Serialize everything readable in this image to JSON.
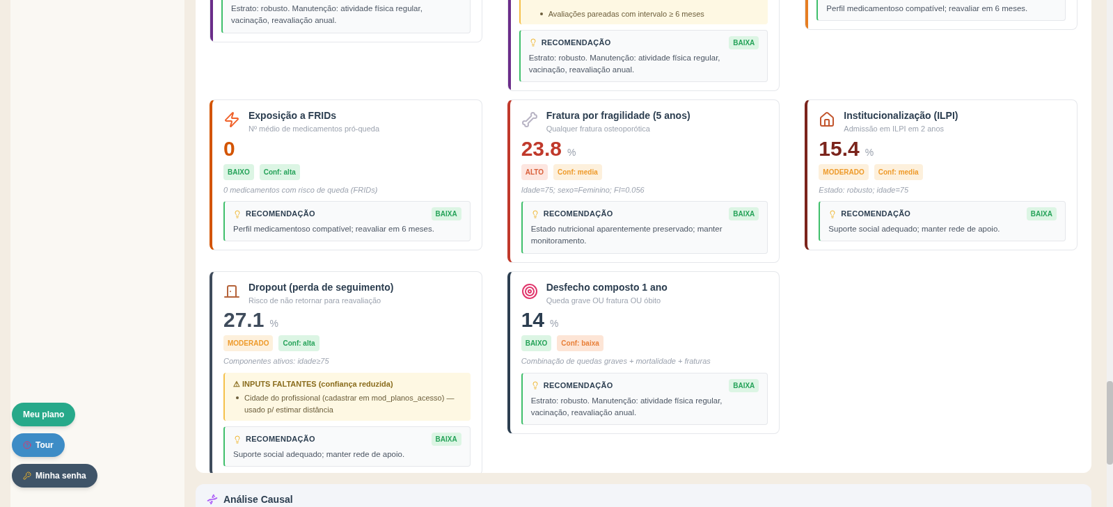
{
  "partial_cards": [
    {
      "color": "#6b2d8a",
      "recommendation": "Estrato: robusto. Manutenção: atividade física regular, vacinação, reavaliação anual."
    },
    {
      "color": "#6b2d8a",
      "missing": [
        "Avaliações pareadas com intervalo ≥ 6 meses"
      ],
      "rec_header": {
        "title": "RECOMENDAÇÃO",
        "priority": "BAIXA"
      },
      "recommendation": "Estrato: robusto. Manutenção: atividade física regular, vacinação, reavaliação anual."
    },
    {
      "color": "#e67e22",
      "recommendation": "Perfil medicamentoso compatível; reavaliar em 6 meses."
    }
  ],
  "cards": [
    {
      "title": "Exposição a FRIDs",
      "subtitle": "Nº médio de medicamentos pró-queda",
      "value": "0",
      "color": "#d35400",
      "badges": [
        {
          "text": "BAIXO",
          "kind": "green"
        },
        {
          "text": "Conf: alta",
          "kind": "green"
        }
      ],
      "note": "0 medicamentos com risco de queda (FRIDs)",
      "rec_title": "RECOMENDAÇÃO",
      "rec_priority": "BAIXA",
      "recommendation": "Perfil medicamentoso compatível; reavaliar em 6 meses."
    },
    {
      "title": "Fratura por fragilidade (5 anos)",
      "subtitle": "Qualquer fratura osteoporótica",
      "value": "23.8",
      "unit": "%",
      "color": "#c0392b",
      "badges": [
        {
          "text": "ALTO",
          "kind": "red"
        },
        {
          "text": "Conf: media",
          "kind": "orange"
        }
      ],
      "note": "Idade=75; sexo=Feminino; FI=0.056",
      "rec_title": "RECOMENDAÇÃO",
      "rec_priority": "BAIXA",
      "recommendation": "Estado nutricional aparentemente preservado; manter monitoramento."
    },
    {
      "title": "Institucionalização (ILPI)",
      "subtitle": "Admissão em ILPI em 2 anos",
      "value": "15.4",
      "unit": "%",
      "color": "#7b241c",
      "badges": [
        {
          "text": "MODERADO",
          "kind": "orange"
        },
        {
          "text": "Conf: media",
          "kind": "orange"
        }
      ],
      "note": "Estado: robusto; idade=75",
      "rec_title": "RECOMENDAÇÃO",
      "rec_priority": "BAIXA",
      "recommendation": "Suporte social adequado; manter rede de apoio."
    },
    {
      "title": "Dropout (perda de seguimento)",
      "subtitle": "Risco de não retornar para reavaliação",
      "value": "27.1",
      "unit": "%",
      "color": "#3f4c5c",
      "badges": [
        {
          "text": "MODERADO",
          "kind": "orange"
        },
        {
          "text": "Conf: alta",
          "kind": "green"
        }
      ],
      "note": "Componentes ativos: idade≥75",
      "missing": {
        "title": "⚠ INPUTS FALTANTES (confiança reduzida)",
        "items": [
          "Cidade do profissional (cadastrar em mod_planos_acesso) — usado p/ estimar distância"
        ]
      },
      "rec_title": "RECOMENDAÇÃO",
      "rec_priority": "BAIXA",
      "recommendation": "Suporte social adequado; manter rede de apoio."
    },
    {
      "title": "Desfecho composto 1 ano",
      "subtitle": "Queda grave OU fratura OU óbito",
      "value": "14",
      "unit": "%",
      "color": "#2c3e50",
      "badges": [
        {
          "text": "BAIXO",
          "kind": "green"
        },
        {
          "text": "Conf: baixa",
          "kind": "peach"
        }
      ],
      "note": "Combinação de quedas graves + mortalidade + fraturas",
      "rec_title": "RECOMENDAÇÃO",
      "rec_priority": "BAIXA",
      "recommendation": "Estrato: robusto. Manutenção: atividade física regular, vacinação, reavaliação anual."
    }
  ],
  "floating_buttons": [
    {
      "label": "Meu plano",
      "kind": "plan"
    },
    {
      "label": "Tour",
      "kind": "tour"
    },
    {
      "label": "Minha senha",
      "kind": "password"
    }
  ],
  "next_section": {
    "title": "Análise Causal"
  }
}
